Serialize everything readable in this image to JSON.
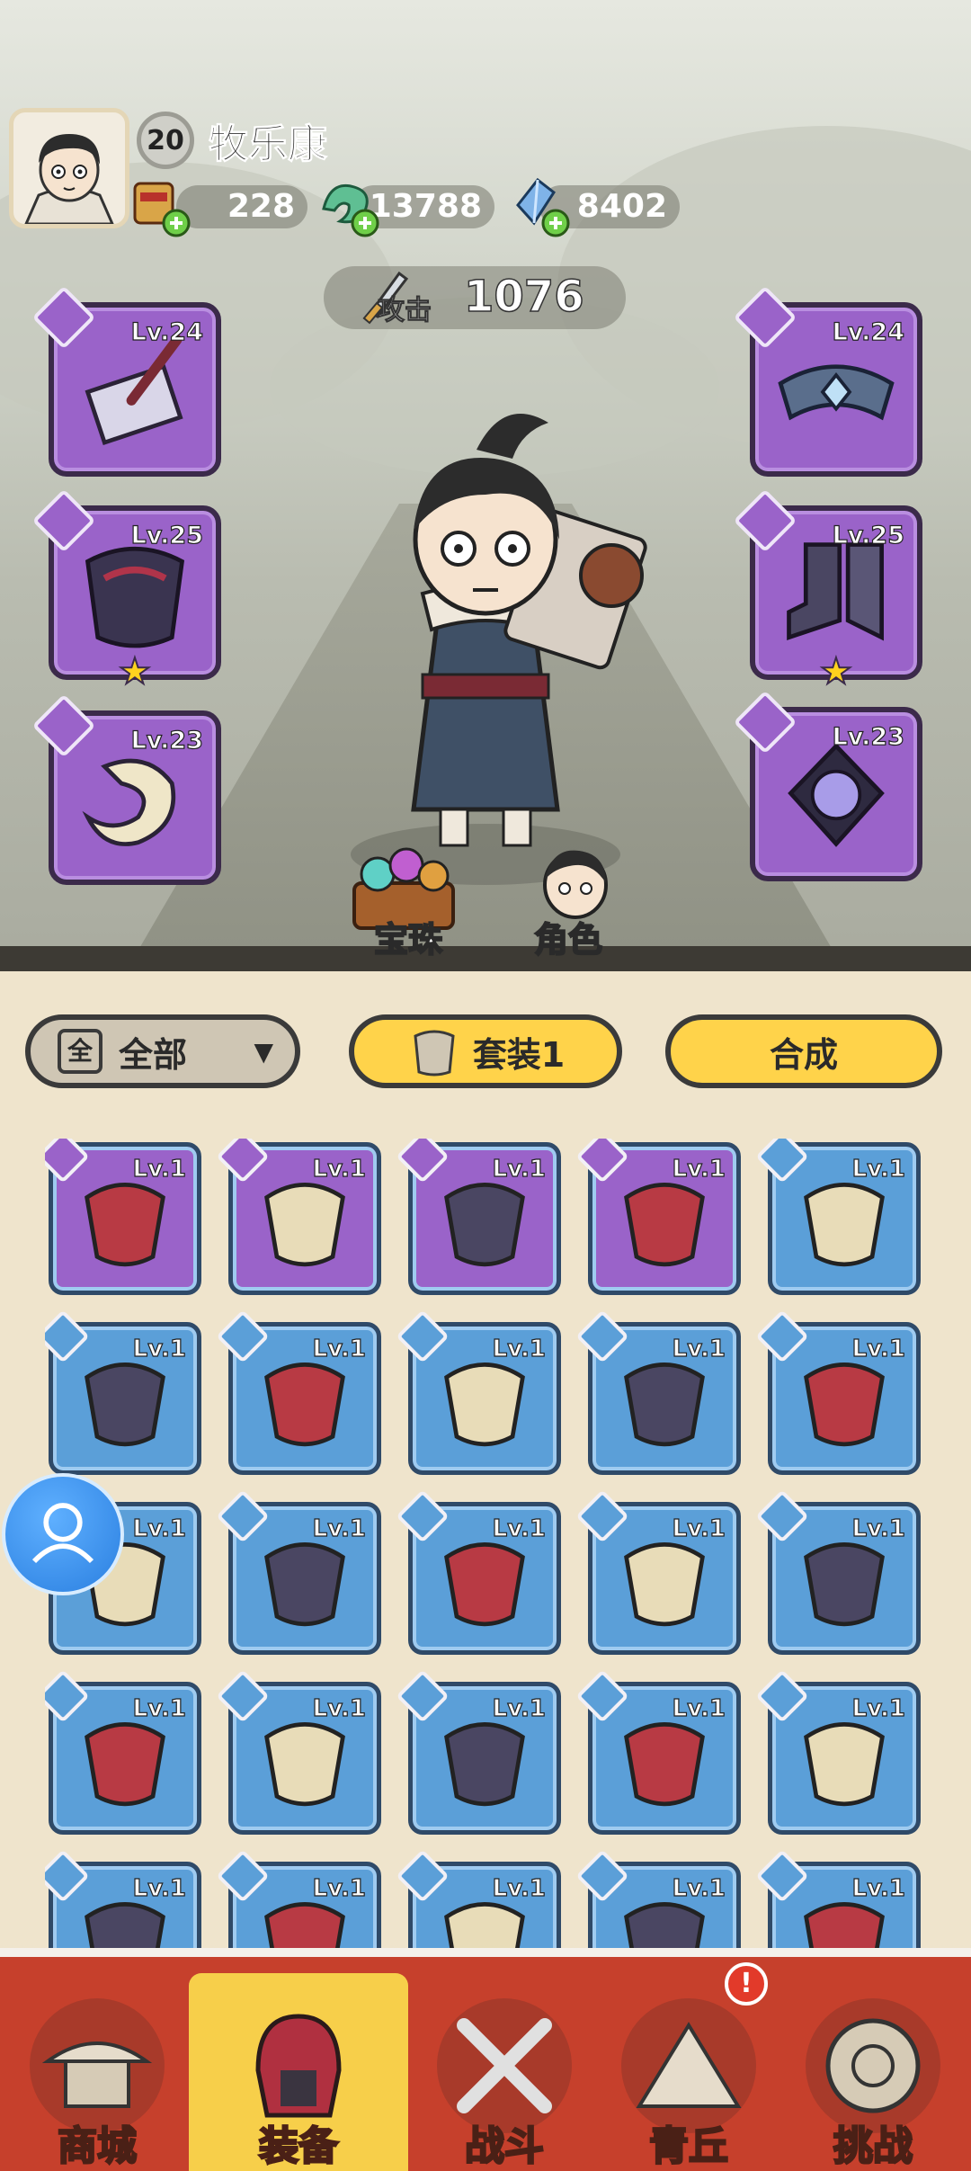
{
  "player": {
    "level": "20",
    "name": "牧乐康"
  },
  "resources": [
    {
      "icon": "scroll-bag-icon",
      "value": "228"
    },
    {
      "icon": "jade-dragon-icon",
      "value": "13788"
    },
    {
      "icon": "crystal-icon",
      "value": "8402"
    }
  ],
  "attack": {
    "label": "攻击",
    "value": "1076"
  },
  "slots_left": [
    {
      "lv": "Lv.24",
      "icon": "weapon-hammer-icon",
      "star": false
    },
    {
      "lv": "Lv.25",
      "icon": "armor-chest-icon",
      "star": true
    },
    {
      "lv": "Lv.23",
      "icon": "bracelet-icon",
      "star": false
    }
  ],
  "slots_right": [
    {
      "lv": "Lv.24",
      "icon": "belt-icon",
      "star": false
    },
    {
      "lv": "Lv.25",
      "icon": "boots-icon",
      "star": true
    },
    {
      "lv": "Lv.23",
      "icon": "amulet-icon",
      "star": false
    }
  ],
  "character_buttons": {
    "gems": "宝珠",
    "role": "角色"
  },
  "filter": {
    "icon": "全",
    "label": "全部"
  },
  "set_button": "套装1",
  "synth_button": "合成",
  "inventory": [
    {
      "lv": "Lv.1",
      "rarity": "purple"
    },
    {
      "lv": "Lv.1",
      "rarity": "purple"
    },
    {
      "lv": "Lv.1",
      "rarity": "purple"
    },
    {
      "lv": "Lv.1",
      "rarity": "purple"
    },
    {
      "lv": "Lv.1",
      "rarity": "blue"
    },
    {
      "lv": "Lv.1",
      "rarity": "blue"
    },
    {
      "lv": "Lv.1",
      "rarity": "blue"
    },
    {
      "lv": "Lv.1",
      "rarity": "blue"
    },
    {
      "lv": "Lv.1",
      "rarity": "blue"
    },
    {
      "lv": "Lv.1",
      "rarity": "blue"
    },
    {
      "lv": "Lv.1",
      "rarity": "blue"
    },
    {
      "lv": "Lv.1",
      "rarity": "blue"
    },
    {
      "lv": "Lv.1",
      "rarity": "blue"
    },
    {
      "lv": "Lv.1",
      "rarity": "blue"
    },
    {
      "lv": "Lv.1",
      "rarity": "blue"
    },
    {
      "lv": "Lv.1",
      "rarity": "blue"
    },
    {
      "lv": "Lv.1",
      "rarity": "blue"
    },
    {
      "lv": "Lv.1",
      "rarity": "blue"
    },
    {
      "lv": "Lv.1",
      "rarity": "blue"
    },
    {
      "lv": "Lv.1",
      "rarity": "blue"
    },
    {
      "lv": "Lv.1",
      "rarity": "blue"
    },
    {
      "lv": "Lv.1",
      "rarity": "blue"
    },
    {
      "lv": "Lv.1",
      "rarity": "blue"
    },
    {
      "lv": "Lv.1",
      "rarity": "blue"
    },
    {
      "lv": "Lv.1",
      "rarity": "blue"
    }
  ],
  "nav": [
    {
      "label": "商城",
      "icon": "shop-pagoda-icon",
      "active": false
    },
    {
      "label": "装备",
      "icon": "equipment-helmet-icon",
      "active": true
    },
    {
      "label": "战斗",
      "icon": "crossed-swords-icon",
      "active": false
    },
    {
      "label": "青丘",
      "icon": "mountain-icon",
      "active": false,
      "badge": "!"
    },
    {
      "label": "挑战",
      "icon": "challenge-medallion-icon",
      "active": false
    }
  ],
  "colors": {
    "purple": "#9a63c9",
    "blue": "#5b9fd8",
    "yellow": "#ffd34a",
    "nav_red": "#c6402c",
    "nav_active": "#f7cf4a"
  }
}
